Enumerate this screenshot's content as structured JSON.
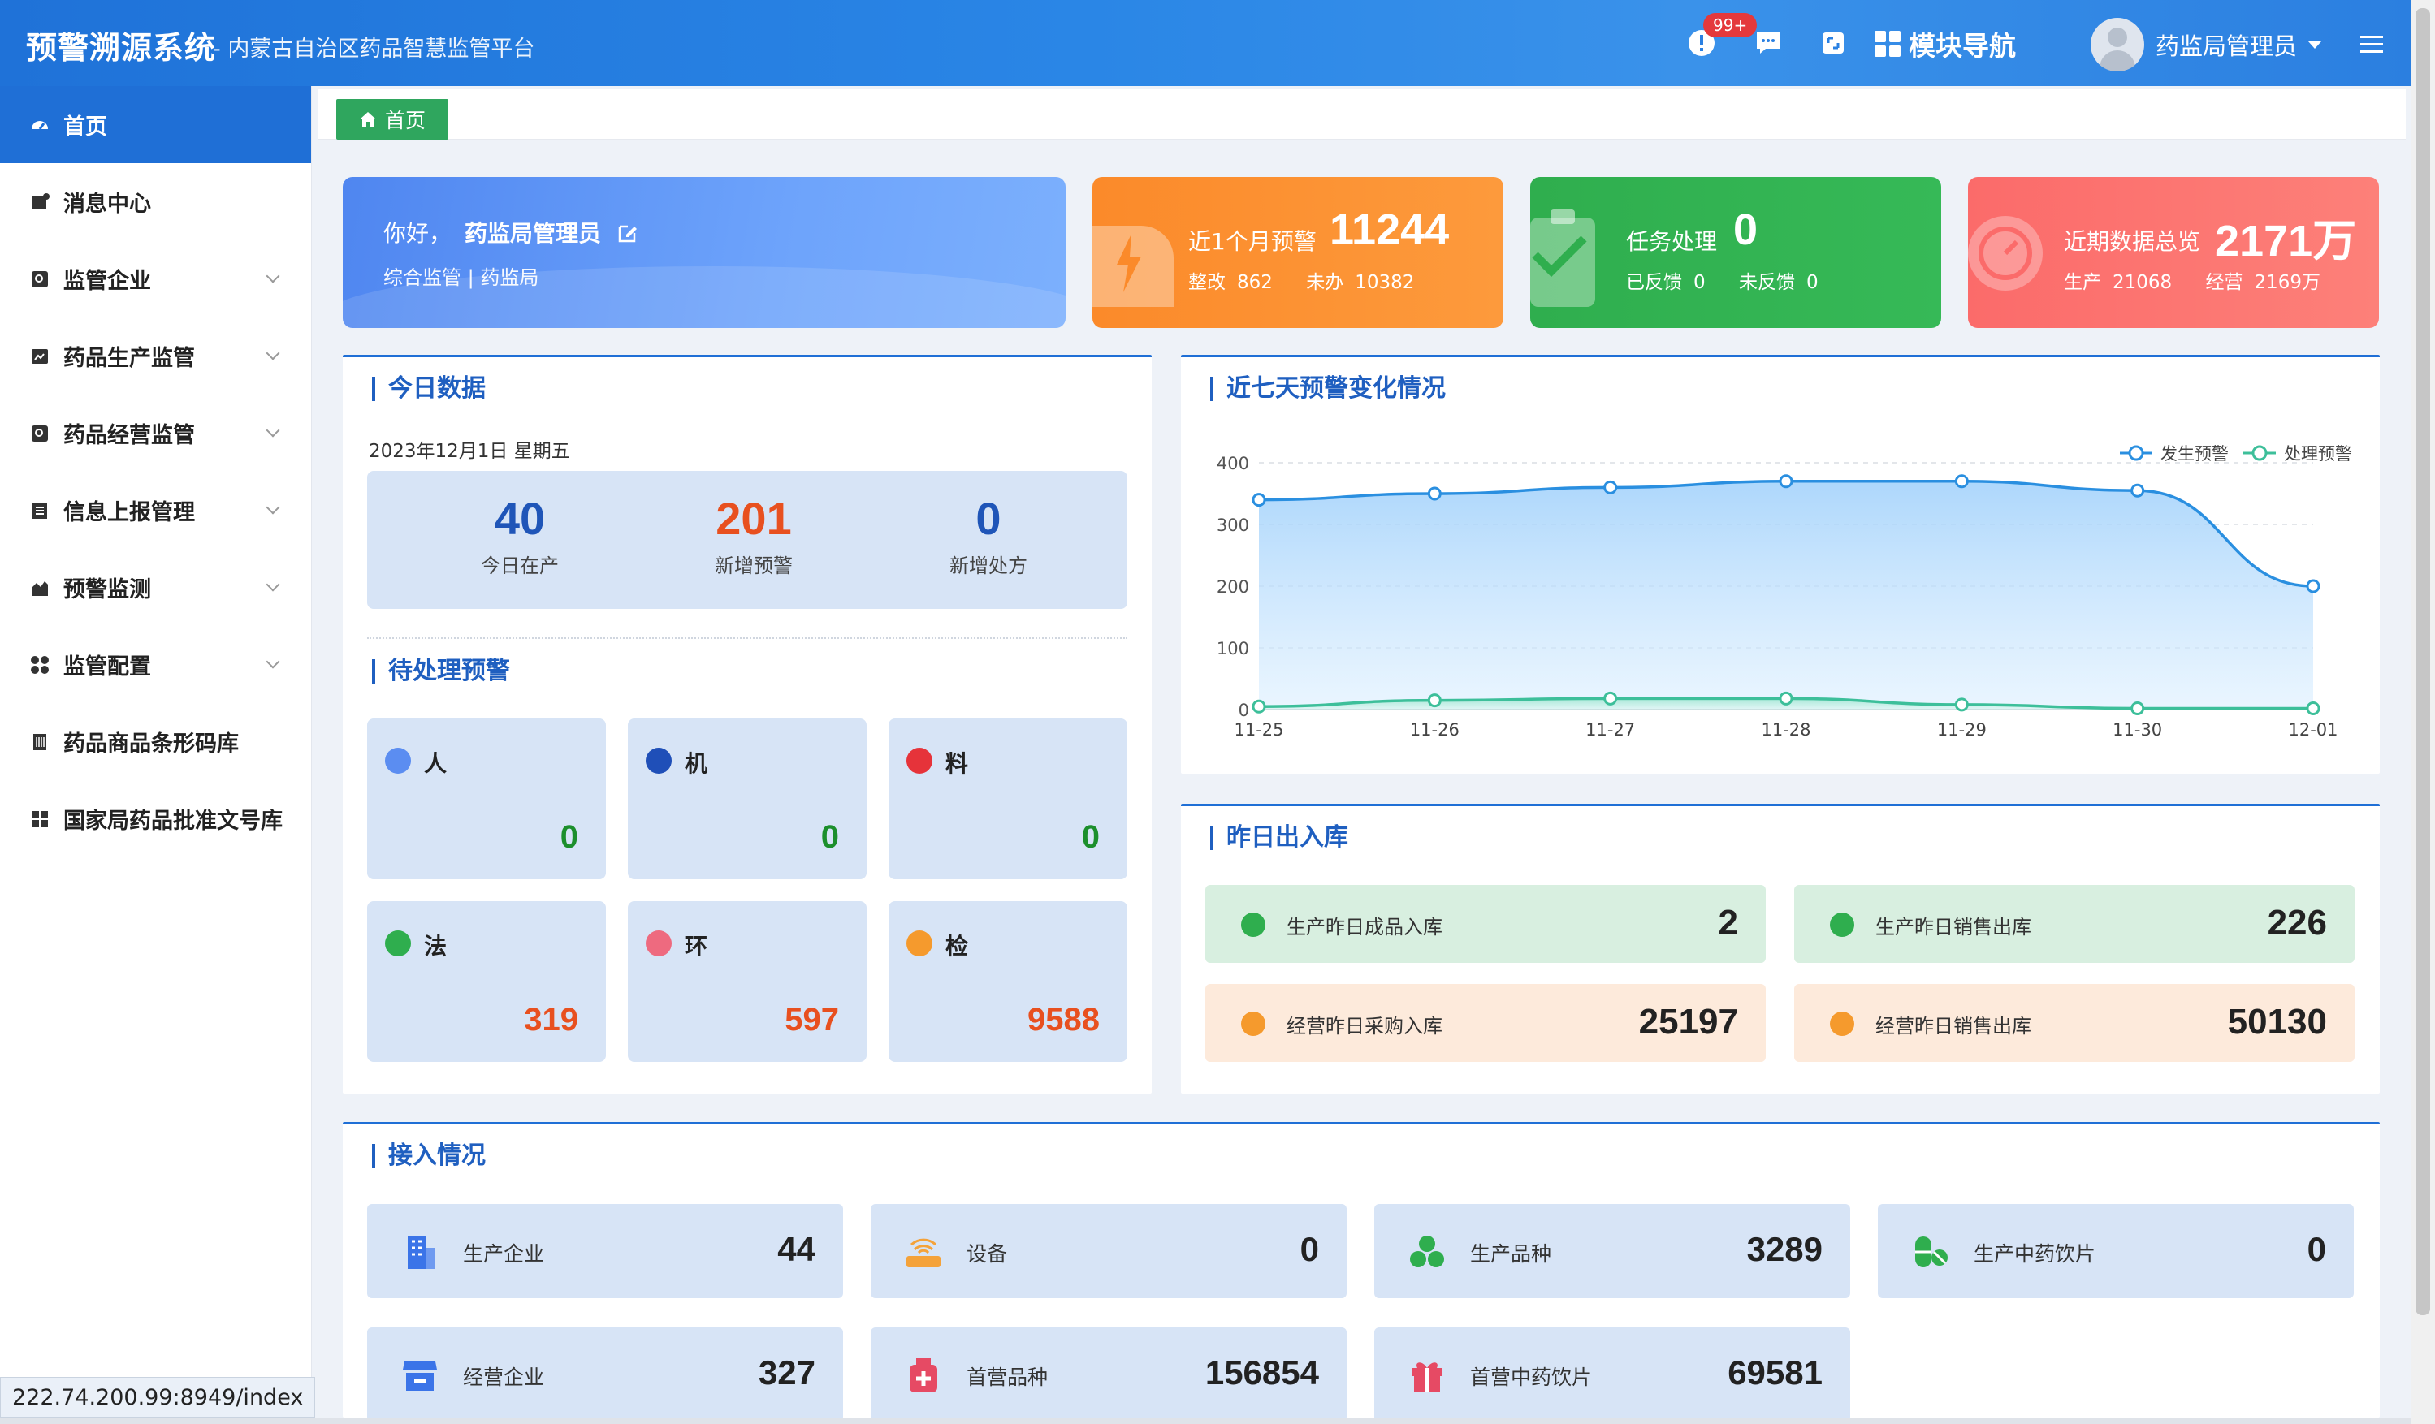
{
  "header": {
    "brand": "预警溯源系统",
    "brand_sub": "- 内蒙古自治区药品智慧监管平台",
    "badge": "99+",
    "module_nav": "模块导航",
    "user_name": "药监局管理员",
    "icons": [
      "alert-icon",
      "chat-icon",
      "fullscreen-icon",
      "grid-icon",
      "menu-icon"
    ]
  },
  "sidebar": {
    "items": [
      {
        "label": "首页",
        "icon": "dashboard-icon",
        "active": true
      },
      {
        "label": "消息中心",
        "icon": "message-icon"
      },
      {
        "label": "监管企业",
        "icon": "company-icon"
      },
      {
        "label": "药品生产监管",
        "icon": "production-icon"
      },
      {
        "label": "药品经营监管",
        "icon": "business-icon"
      },
      {
        "label": "信息上报管理",
        "icon": "report-icon"
      },
      {
        "label": "预警监测",
        "icon": "monitor-icon"
      },
      {
        "label": "监管配置",
        "icon": "config-icon"
      },
      {
        "label": "药品商品条形码库",
        "icon": "barcode-icon"
      },
      {
        "label": "国家局药品批准文号库",
        "icon": "license-icon"
      }
    ]
  },
  "status_url": "222.74.200.99:8949/index",
  "tab": {
    "home": "首页"
  },
  "welcome": {
    "greeting": "你好，",
    "name": "药监局管理员",
    "sub": "综合监管 | 药监局"
  },
  "stats": [
    {
      "label": "近1个月预警",
      "value": "11244",
      "row": [
        {
          "k": "整改",
          "v": "862"
        },
        {
          "k": "未办",
          "v": "10382"
        }
      ],
      "color": "#fb8c2a"
    },
    {
      "label": "任务处理",
      "value": "0",
      "row": [
        {
          "k": "已反馈",
          "v": "0"
        },
        {
          "k": "未反馈",
          "v": "0"
        }
      ],
      "color": "#2fae4e"
    },
    {
      "label": "近期数据总览",
      "value": "2171万",
      "row": [
        {
          "k": "生产",
          "v": "21068"
        },
        {
          "k": "经营",
          "v": "2169万"
        }
      ],
      "color": "#fb6f6a"
    }
  ],
  "today": {
    "title": "今日数据",
    "date": "2023年12月1日 星期五",
    "cells": [
      {
        "value": "40",
        "label": "今日在产",
        "color": "#1f55b8"
      },
      {
        "value": "201",
        "label": "新增预警",
        "color": "#e8501f"
      },
      {
        "value": "0",
        "label": "新增处方",
        "color": "#1f55b8"
      }
    ]
  },
  "pending": {
    "title": "待处理预警",
    "items": [
      {
        "name": "人",
        "count": "0",
        "dot": "#5b8df1",
        "ccolor": "#1c8f2c"
      },
      {
        "name": "机",
        "count": "0",
        "dot": "#1f4fb8",
        "ccolor": "#1c8f2c"
      },
      {
        "name": "料",
        "count": "0",
        "dot": "#e6333a",
        "ccolor": "#1c8f2c"
      },
      {
        "name": "法",
        "count": "319",
        "dot": "#2fae4e",
        "ccolor": "#e8501f"
      },
      {
        "name": "环",
        "count": "597",
        "dot": "#ee6a7f",
        "ccolor": "#e8501f"
      },
      {
        "name": "检",
        "count": "9588",
        "dot": "#f59a2d",
        "ccolor": "#e8501f"
      }
    ]
  },
  "trend": {
    "title": "近七天预警变化情况"
  },
  "chart_data": {
    "type": "line",
    "x": [
      "11-25",
      "11-26",
      "11-27",
      "11-28",
      "11-29",
      "11-30",
      "12-01"
    ],
    "series": [
      {
        "name": "发生预警",
        "values": [
          340,
          350,
          360,
          370,
          370,
          355,
          200
        ],
        "color": "#2a8fe0"
      },
      {
        "name": "处理预警",
        "values": [
          5,
          15,
          18,
          18,
          8,
          2,
          2
        ],
        "color": "#3dbf9a"
      }
    ],
    "yticks": [
      "0",
      "100",
      "200",
      "300",
      "400"
    ],
    "ylim": [
      0,
      400
    ],
    "grid": true,
    "legend": "top-right"
  },
  "yesterday": {
    "title": "昨日出入库",
    "items": [
      {
        "label": "生产昨日成品入库",
        "value": "2",
        "bg": "#d8efe0",
        "dot": "#2fae4e"
      },
      {
        "label": "生产昨日销售出库",
        "value": "226",
        "bg": "#d8efe0",
        "dot": "#2fae4e"
      },
      {
        "label": "经营昨日采购入库",
        "value": "25197",
        "bg": "#fdeadb",
        "dot": "#f59a2d"
      },
      {
        "label": "经营昨日销售出库",
        "value": "50130",
        "bg": "#fdeadb",
        "dot": "#f59a2d"
      }
    ]
  },
  "access": {
    "title": "接入情况",
    "items": [
      {
        "label": "生产企业",
        "value": "44",
        "icon": "building-icon"
      },
      {
        "label": "设备",
        "value": "0",
        "icon": "router-icon"
      },
      {
        "label": "生产品种",
        "value": "3289",
        "icon": "cluster-icon"
      },
      {
        "label": "生产中药饮片",
        "value": "0",
        "icon": "capsule-icon"
      },
      {
        "label": "经营企业",
        "value": "327",
        "icon": "store-icon"
      },
      {
        "label": "首营品种",
        "value": "156854",
        "icon": "medkit-icon"
      },
      {
        "label": "首营中药饮片",
        "value": "69581",
        "icon": "gift-icon"
      }
    ]
  }
}
